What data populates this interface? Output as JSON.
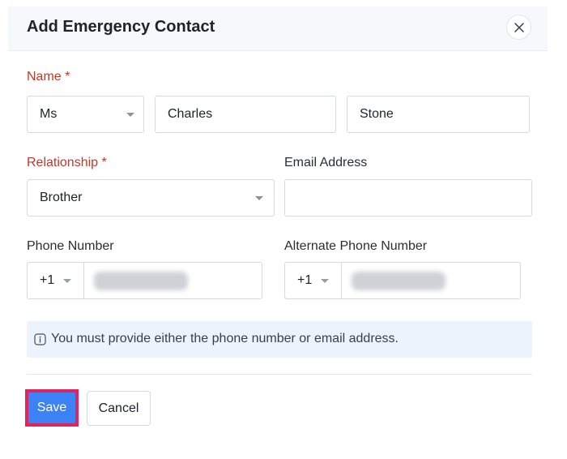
{
  "dialog": {
    "title": "Add Emergency Contact"
  },
  "form": {
    "name_label": "Name *",
    "salutation_value": "Ms",
    "first_name_value": "Charles",
    "last_name_value": "Stone",
    "relationship_label": "Relationship *",
    "relationship_value": "Brother",
    "email_label": "Email Address",
    "email_value": "",
    "phone_label": "Phone Number",
    "phone_code": "+1",
    "alt_phone_label": "Alternate Phone Number",
    "alt_phone_code": "+1",
    "info_text": "You must provide either the phone number or email address."
  },
  "actions": {
    "save_label": "Save",
    "cancel_label": "Cancel"
  },
  "colors": {
    "required_label": "#c0392b",
    "primary_button": "#3b82f6",
    "highlight_border": "#e0245e",
    "info_background": "#edf3fc"
  }
}
